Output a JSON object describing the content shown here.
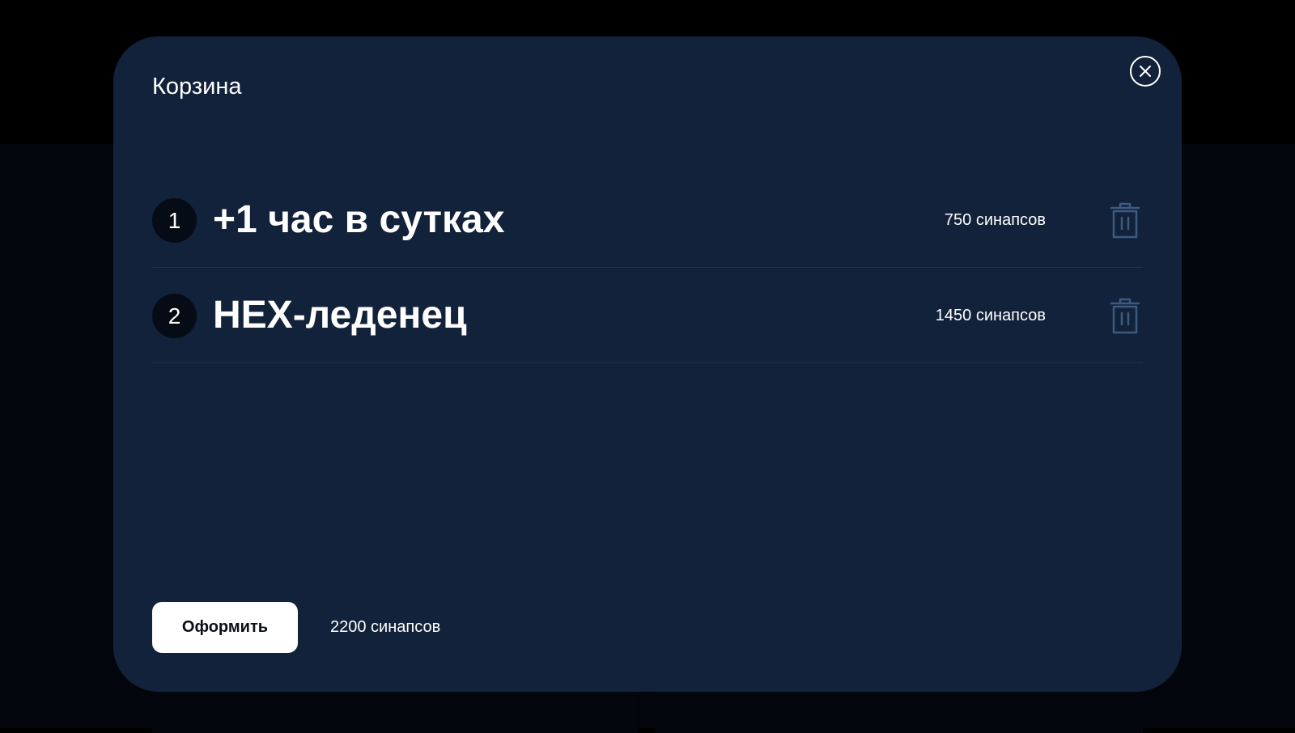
{
  "modal": {
    "title": "Корзина",
    "close_icon": "close-icon"
  },
  "cart": {
    "items": [
      {
        "index": "1",
        "title": "+1 час в сутках",
        "price": "750 синапсов",
        "delete_icon": "trash-icon"
      },
      {
        "index": "2",
        "title": "HEX-леденец",
        "price": "1450 синапсов",
        "delete_icon": "trash-icon"
      }
    ]
  },
  "footer": {
    "checkout_label": "Оформить",
    "total": "2200 синапсов"
  },
  "colors": {
    "modal_bg": "#12223a",
    "backdrop": "#000000",
    "trash_icon": "#3d5a80",
    "button_bg": "#ffffff"
  }
}
